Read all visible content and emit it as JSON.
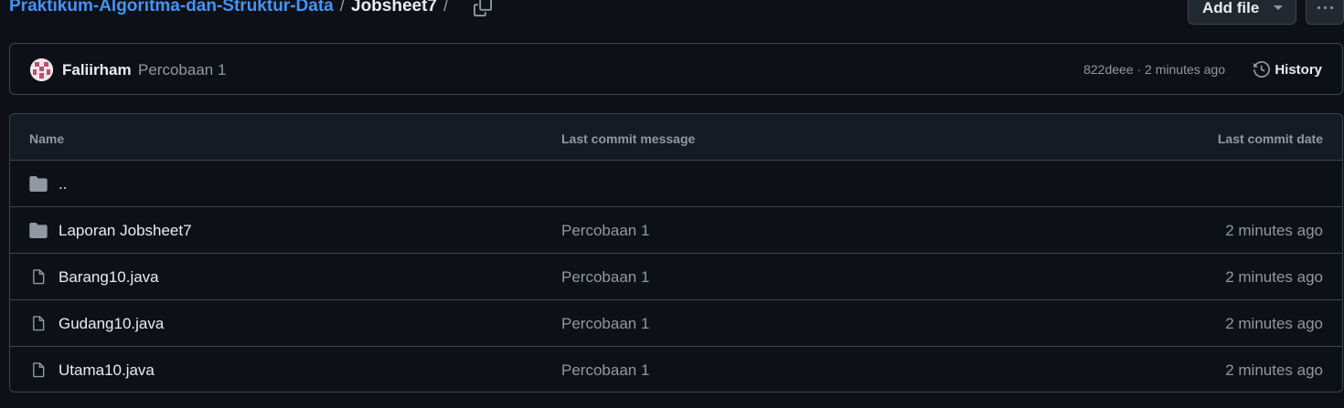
{
  "breadcrumb": {
    "repo": "Praktikum-Algoritma-dan-Struktur-Data",
    "separator": "/",
    "current": "Jobsheet7",
    "trailing": "/"
  },
  "toolbar": {
    "add_file_label": "Add file",
    "copy_icon": "copy-icon",
    "more_icon": "kebab-horizontal-icon"
  },
  "commit": {
    "author": "Faliirham",
    "message": "Percobaan 1",
    "meta": "822deee · 2 minutes ago",
    "history_label": "History"
  },
  "table": {
    "headers": {
      "name": "Name",
      "message": "Last commit message",
      "date": "Last commit date"
    },
    "parent": "..",
    "rows": [
      {
        "name": "Laporan Jobsheet7",
        "type": "folder",
        "message": "Percobaan 1",
        "date": "2 minutes ago"
      },
      {
        "name": "Barang10.java",
        "type": "file",
        "message": "Percobaan 1",
        "date": "2 minutes ago"
      },
      {
        "name": "Gudang10.java",
        "type": "file",
        "message": "Percobaan 1",
        "date": "2 minutes ago"
      },
      {
        "name": "Utama10.java",
        "type": "file",
        "message": "Percobaan 1",
        "date": "2 minutes ago"
      }
    ]
  },
  "colors": {
    "background": "#0d1117",
    "link": "#4493f8",
    "muted": "#9198a1",
    "border": "#3d444d"
  }
}
